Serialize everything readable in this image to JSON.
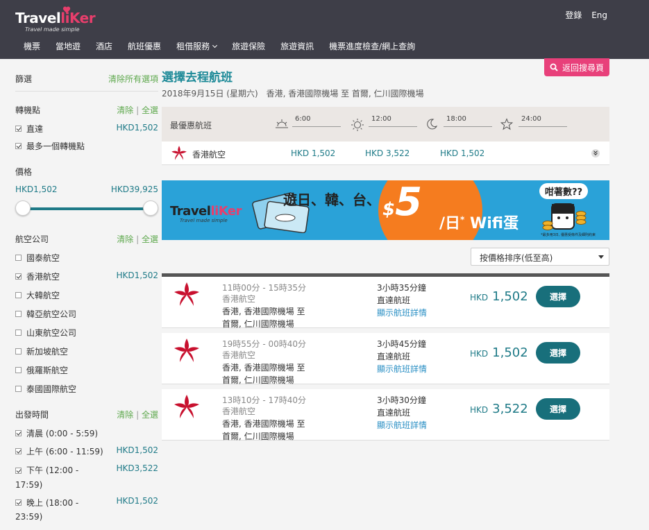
{
  "brand": {
    "name_a": "Travel",
    "name_b": "liKer",
    "tagline": "Travel made simple"
  },
  "header": {
    "login": "登錄",
    "lang": "Eng",
    "nav": [
      "機票",
      "當地遊",
      "酒店",
      "航班優惠",
      "租借服務",
      "旅遊保險",
      "旅遊資訊",
      "機票進度檢查/網上查詢"
    ]
  },
  "back_button": "返回搜尋頁",
  "sidebar": {
    "filter_title": "篩選",
    "clear_all": "清除所有選項",
    "clear": "清除",
    "divider": "|",
    "select_all": "全選",
    "transfer": {
      "title": "轉機點",
      "items": [
        {
          "label": "直達",
          "price": "HKD1,502",
          "checked": true
        },
        {
          "label": "最多一個轉機點",
          "price": "",
          "checked": true
        }
      ]
    },
    "price": {
      "title": "價格",
      "min": "HKD1,502",
      "max": "HKD39,925"
    },
    "airlines": {
      "title": "航空公司",
      "items": [
        {
          "label": "國泰航空",
          "price": "",
          "checked": false
        },
        {
          "label": "香港航空",
          "price": "HKD1,502",
          "checked": true
        },
        {
          "label": "大韓航空",
          "price": "",
          "checked": false
        },
        {
          "label": "韓亞航空公司",
          "price": "",
          "checked": false
        },
        {
          "label": "山東航空公司",
          "price": "",
          "checked": false
        },
        {
          "label": "新加坡航空",
          "price": "",
          "checked": false
        },
        {
          "label": "俄羅斯航空",
          "price": "",
          "checked": false
        },
        {
          "label": "泰國國際航空",
          "price": "",
          "checked": false
        }
      ]
    },
    "departure": {
      "title": "出發時間",
      "items": [
        {
          "label": "清晨 (0:00 - 5:59)",
          "price": "",
          "checked": true
        },
        {
          "label": "上午 (6:00 - 11:59)",
          "price": "HKD1,502",
          "checked": true
        },
        {
          "label_a": "下午 (12:00 -",
          "label_b": "17:59)",
          "price": "HKD3,522",
          "checked": true
        },
        {
          "label_a": "晚上 (18:00 -",
          "label_b": "23:59)",
          "price": "HKD1,502",
          "checked": true
        }
      ]
    }
  },
  "main": {
    "title": "選擇去程航班",
    "subtitle": "2018年9月15日 (星期六)　香港, 香港國際機場 至 首爾, 仁川國際機場",
    "best": {
      "label": "最優惠航班",
      "times": [
        "6:00",
        "12:00",
        "18:00",
        "24:00"
      ],
      "airline": "香港航空",
      "prices": [
        "HKD 1,502",
        "HKD 3,522",
        "HKD 1,502"
      ]
    },
    "banner": {
      "logo_a": "Travel",
      "logo_b": "liKer",
      "tagline": "Travel made simple",
      "heading": "遊日、韓、台、泰",
      "dollar": "$",
      "five": "5",
      "per_day": "/日",
      "star": "*",
      "wifi": "Wifi蛋",
      "bubble": "咁著數??",
      "fine": "*最多用3日, 優惠受條件及細則約束"
    },
    "sort": "按價格排序(低至高)",
    "flights": [
      {
        "time": "11時00分 - 15時35分",
        "airline": "香港航空",
        "route_a": "香港, 香港國際機場 至",
        "route_b": "首爾, 仁川國際機場",
        "duration": "3小時35分鐘",
        "type": "直達航班",
        "detail": "顯示航班詳情",
        "currency": "HKD",
        "price": "1,502",
        "select": "選擇"
      },
      {
        "time": "19時55分 - 00時40分",
        "airline": "香港航空",
        "route_a": "香港, 香港國際機場 至",
        "route_b": "首爾, 仁川國際機場",
        "duration": "3小時45分鐘",
        "type": "直達航班",
        "detail": "顯示航班詳情",
        "currency": "HKD",
        "price": "1,502",
        "select": "選擇"
      },
      {
        "time": "13時10分 - 17時40分",
        "airline": "香港航空",
        "route_a": "香港, 香港國際機場 至",
        "route_b": "首爾, 仁川國際機場",
        "duration": "3小時30分鐘",
        "type": "直達航班",
        "detail": "顯示航班詳情",
        "currency": "HKD",
        "price": "3,522",
        "select": "選擇"
      }
    ]
  },
  "colors": {
    "header_bg": "#3e3e48",
    "teal": "#1e7a87",
    "pink": "#e8407a",
    "orange": "#f57c1f",
    "banner_blue": "#2aa2d8"
  }
}
